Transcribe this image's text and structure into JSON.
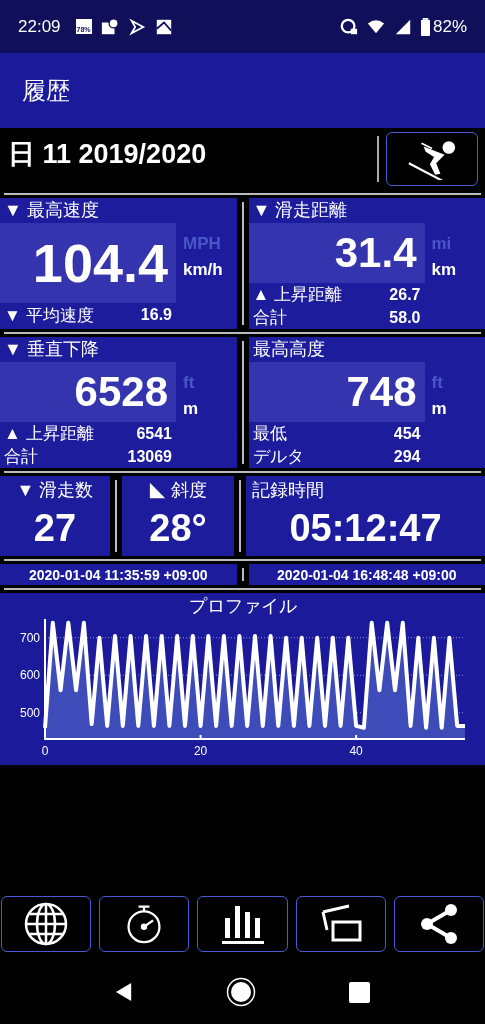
{
  "status_bar": {
    "time": "22:09",
    "notification_badge": "78%",
    "battery": "82%"
  },
  "app_bar": {
    "title": "履歴"
  },
  "header": {
    "date": "日 11 2019/2020"
  },
  "big_panels": [
    {
      "title": "▼ 最高速度",
      "value": "104.4",
      "units": [
        {
          "label": "MPH",
          "selected": false
        },
        {
          "label": "km/h",
          "selected": true
        }
      ],
      "rows": [
        {
          "label": "▼ 平均速度",
          "value": "16.9"
        }
      ]
    },
    {
      "title": "▼ 滑走距離",
      "value": "31.4",
      "units": [
        {
          "label": "mi",
          "selected": false
        },
        {
          "label": "km",
          "selected": true
        }
      ],
      "rows": [
        {
          "label": "▲ 上昇距離",
          "value": "26.7"
        },
        {
          "label": "合計",
          "value": "58.0"
        }
      ]
    },
    {
      "title": "▼ 垂直下降",
      "value": "6528",
      "units": [
        {
          "label": "ft",
          "selected": false
        },
        {
          "label": "m",
          "selected": true
        }
      ],
      "rows": [
        {
          "label": "▲ 上昇距離",
          "value": "6541"
        },
        {
          "label": "合計",
          "value": "13069"
        }
      ]
    },
    {
      "title": "最高高度",
      "value": "748",
      "units": [
        {
          "label": "ft",
          "selected": false
        },
        {
          "label": "m",
          "selected": true
        }
      ],
      "rows": [
        {
          "label": "最低",
          "value": "454"
        },
        {
          "label": "デルタ",
          "value": "294"
        }
      ]
    }
  ],
  "small_panels": [
    {
      "kind": "plain",
      "title": "▼ 滑走数",
      "value": "27"
    },
    {
      "kind": "slope",
      "title": "斜度",
      "value": "28°"
    },
    {
      "kind": "plain",
      "title": "記録時間",
      "value": "05:12:47"
    }
  ],
  "timestamps": [
    "2020-01-04 11:35:59 +09:00",
    "2020-01-04 16:48:48 +09:00"
  ],
  "profile": {
    "chart_data": {
      "type": "area",
      "title": "プロファイル",
      "x": [
        0,
        1,
        2,
        3,
        4,
        5,
        6,
        7,
        8,
        9,
        10,
        11,
        12,
        13,
        14,
        15,
        16,
        17,
        18,
        19,
        20,
        21,
        22,
        23,
        24,
        25,
        26,
        27,
        28,
        29,
        30,
        31,
        32,
        33,
        34,
        35,
        36,
        37,
        38,
        39,
        40,
        41,
        42,
        43,
        44,
        45,
        46,
        47,
        48,
        49,
        50,
        51,
        52,
        53,
        54
      ],
      "series": [
        {
          "color": "#ffffff",
          "values": [
            460,
            740,
            560,
            740,
            560,
            740,
            470,
            700,
            465,
            705,
            465,
            705,
            465,
            705,
            465,
            705,
            465,
            705,
            465,
            705,
            465,
            705,
            465,
            705,
            465,
            705,
            465,
            705,
            465,
            705,
            465,
            700,
            465,
            700,
            465,
            700,
            465,
            700,
            465,
            700,
            465,
            460,
            740,
            560,
            740,
            560,
            740,
            465,
            700,
            460,
            700,
            460,
            700,
            465,
            465
          ]
        }
      ],
      "grid": true,
      "xlim": [
        0,
        54
      ],
      "ylim": [
        430,
        750
      ],
      "xticks": [
        0,
        20,
        40
      ],
      "yticks": [
        500,
        600,
        700
      ]
    }
  }
}
